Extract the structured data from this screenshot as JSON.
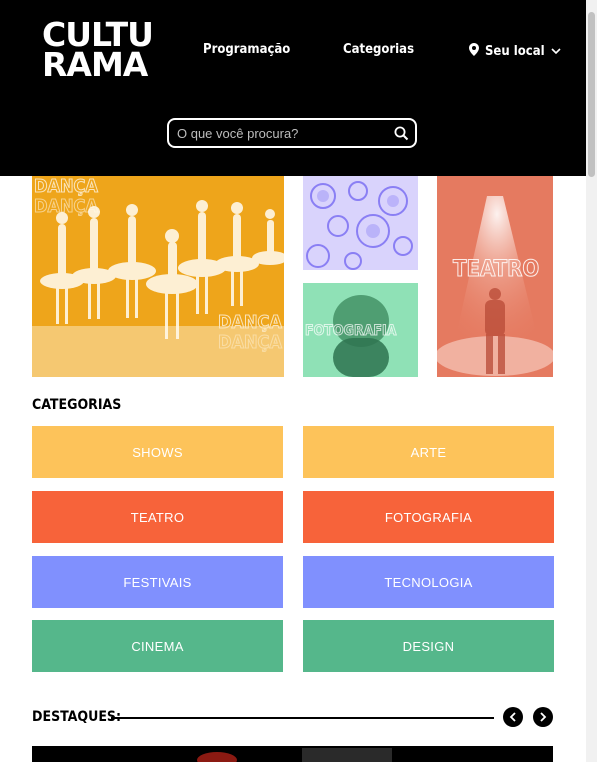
{
  "header": {
    "logo_line1": "CULTU",
    "logo_line2": "RAMA",
    "nav_programacao": "Programação",
    "nav_categorias": "Categorias",
    "nav_local": "Seu local",
    "search_placeholder": "O que você procura?"
  },
  "gallery": {
    "danca_text": "DANÇA",
    "foto_text": "FOTOGRAFIA",
    "teatro_text": "TEATRO"
  },
  "categories": {
    "title": "CATEGORIAS",
    "items": [
      {
        "label": "SHOWS",
        "color": "#fdc35a"
      },
      {
        "label": "ARTE",
        "color": "#fdc35a"
      },
      {
        "label": "TEATRO",
        "color": "#f7633a"
      },
      {
        "label": "FOTOGRAFIA",
        "color": "#f7633a"
      },
      {
        "label": "FESTIVAIS",
        "color": "#8090fe"
      },
      {
        "label": "TECNOLOGIA",
        "color": "#8090fe"
      },
      {
        "label": "CINEMA",
        "color": "#55b78b"
      },
      {
        "label": "DESIGN",
        "color": "#55b78b"
      }
    ]
  },
  "destaques": {
    "title": "DESTAQUES:"
  }
}
